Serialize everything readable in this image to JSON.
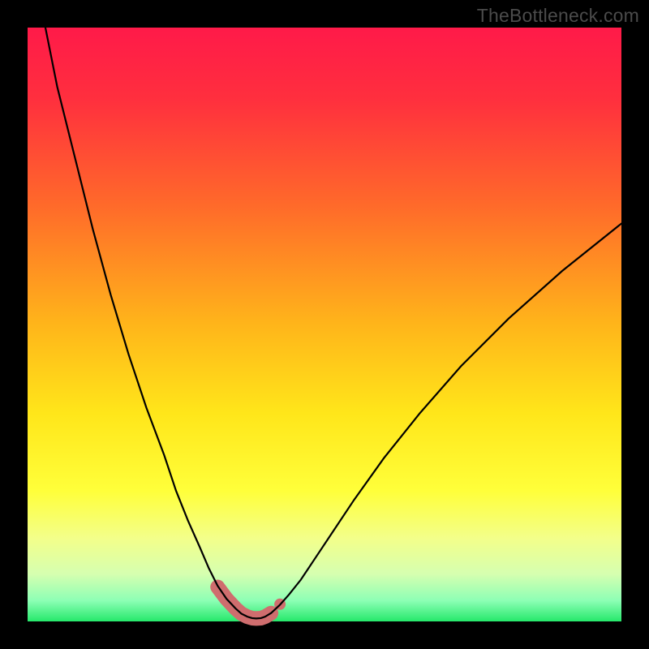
{
  "watermark": {
    "text": "TheBottleneck.com"
  },
  "colors": {
    "marker": "#cf6d6e",
    "gradient_stops": [
      {
        "pct": 0,
        "color": "#ff1a49"
      },
      {
        "pct": 12,
        "color": "#ff2f3e"
      },
      {
        "pct": 30,
        "color": "#ff6a2a"
      },
      {
        "pct": 50,
        "color": "#ffb51a"
      },
      {
        "pct": 65,
        "color": "#ffe61a"
      },
      {
        "pct": 78,
        "color": "#ffff3a"
      },
      {
        "pct": 86,
        "color": "#f3ff8a"
      },
      {
        "pct": 92,
        "color": "#d6ffb0"
      },
      {
        "pct": 96.5,
        "color": "#8dffb5"
      },
      {
        "pct": 100,
        "color": "#26e86b"
      }
    ]
  },
  "chart_data": {
    "type": "line",
    "title": "",
    "xlabel": "",
    "ylabel": "",
    "xlim": [
      0,
      100
    ],
    "ylim": [
      0,
      100
    ],
    "grid": false,
    "series": [
      {
        "name": "bottleneck-curve",
        "x": [
          3,
          5,
          8,
          11,
          14,
          17,
          20,
          23,
          25,
          27,
          29,
          30.5,
          32,
          33.5,
          35,
          36,
          37,
          37.8,
          38.5,
          39.3,
          40,
          41,
          42.5,
          44,
          46,
          48,
          51,
          55,
          60,
          66,
          73,
          81,
          90,
          100
        ],
        "y": [
          100,
          90,
          78,
          66,
          55,
          45,
          36,
          28,
          22,
          17,
          12.5,
          9,
          6,
          3.8,
          2.2,
          1.3,
          0.8,
          0.55,
          0.5,
          0.55,
          0.8,
          1.4,
          2.8,
          4.5,
          7,
          10,
          14.5,
          20.5,
          27.5,
          35,
          43,
          51,
          59,
          67
        ]
      }
    ],
    "floor_marker": {
      "x": [
        32,
        33.5,
        35,
        36,
        37,
        37.8,
        38.5,
        39.3,
        40,
        41
      ],
      "y": [
        5.8,
        3.8,
        2.2,
        1.3,
        0.8,
        0.55,
        0.5,
        0.55,
        0.8,
        1.4
      ]
    },
    "floor_dot": {
      "x": 42.5,
      "y": 2.9
    }
  }
}
